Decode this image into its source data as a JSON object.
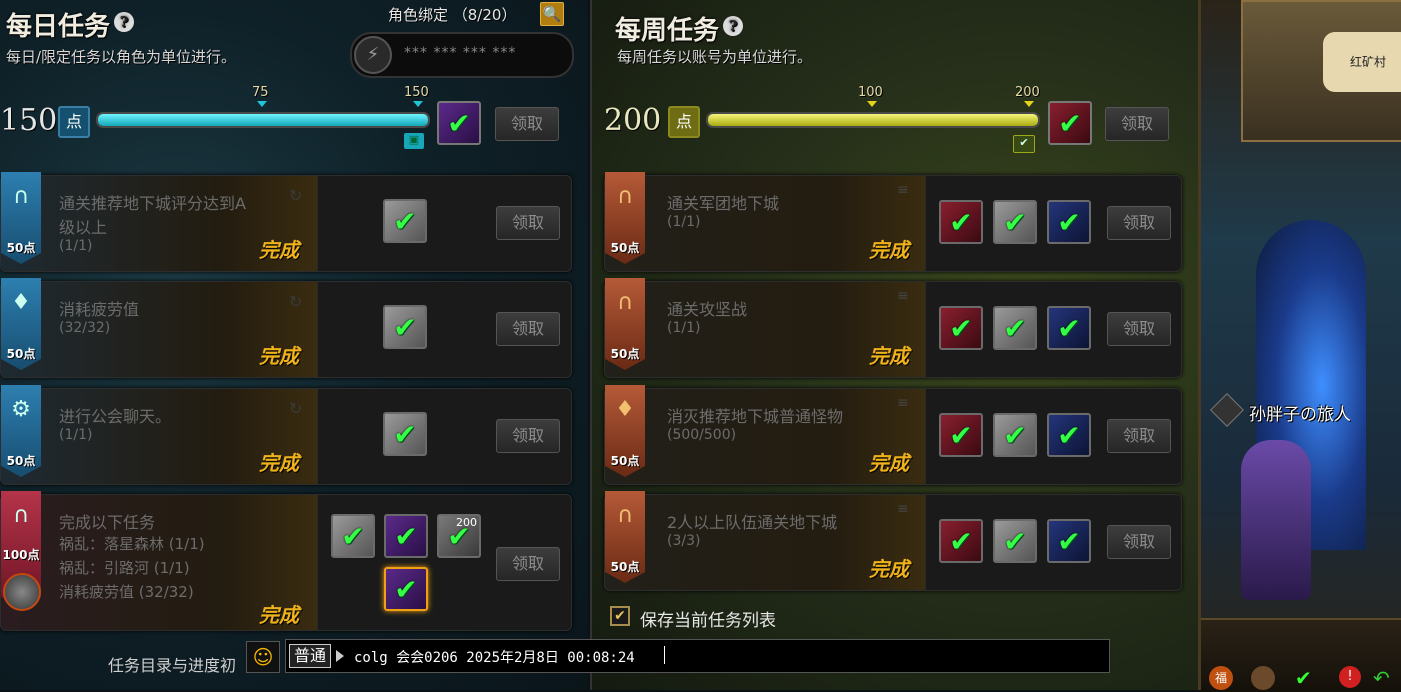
{
  "daily": {
    "title": "每日任务",
    "help": "?",
    "subtitle": "每日/限定任务以角色为单位进行。",
    "bind_label": "角色绑定 （8/20）",
    "search_icon": "search-icon",
    "masked_code": "*** *** *** ***",
    "points_value": "150",
    "points_unit": "点",
    "progress": {
      "current": 150,
      "max": 150,
      "marks": [
        75,
        150
      ],
      "mark_labels": [
        "75",
        "150"
      ]
    },
    "claim_label": "领取",
    "quests": [
      {
        "points": "50点",
        "name": "通关推荐地下城评分达到A级以上",
        "name_l1": "通关推荐地下城评分达到A",
        "name_l2": "级以上",
        "progress": "(1/1)",
        "status": "完成",
        "claim": "领取"
      },
      {
        "points": "50点",
        "name": "消耗疲劳值",
        "progress": "(32/32)",
        "status": "完成",
        "claim": "领取"
      },
      {
        "points": "50点",
        "name": "进行公会聊天。",
        "progress": "(1/1)",
        "status": "完成",
        "claim": "领取"
      },
      {
        "points": "100点",
        "name": "完成以下任务",
        "subs": [
          "祸乱：落星森林 (1/1)",
          "祸乱：引路河 (1/1)",
          "消耗疲劳值 (32/32)"
        ],
        "status": "完成",
        "claim": "领取",
        "reward_badge": "200"
      }
    ],
    "footer_text": "任务目录与进度初"
  },
  "weekly": {
    "title": "每周任务",
    "help": "?",
    "subtitle": "每周任务以账号为单位进行。",
    "points_value": "200",
    "points_unit": "点",
    "progress": {
      "current": 200,
      "max": 200,
      "marks": [
        100,
        200
      ],
      "mark_labels": [
        "100",
        "200"
      ]
    },
    "claim_label": "领取",
    "quests": [
      {
        "points": "50点",
        "name": "通关军团地下城",
        "progress": "(1/1)",
        "status": "完成",
        "claim": "领取"
      },
      {
        "points": "50点",
        "name": "通关攻坚战",
        "progress": "(1/1)",
        "status": "完成",
        "claim": "领取"
      },
      {
        "points": "50点",
        "name": "消灭推荐地下城普通怪物",
        "progress": "(500/500)",
        "status": "完成",
        "claim": "领取"
      },
      {
        "points": "50点",
        "name": "2人以上队伍通关地下城",
        "progress": "(3/3)",
        "status": "完成",
        "claim": "领取"
      }
    ],
    "save_label": "保存当前任务列表"
  },
  "chat": {
    "channel": "普通",
    "message": "colg 会会0206 2025年2月8日 00:08:24"
  },
  "scene": {
    "sign_text": "红矿村",
    "player_name": "孙胖子の旅人"
  },
  "colors": {
    "daily_bar": "#1fc6d8",
    "weekly_bar": "#c9cc1a",
    "done": "#f0b21a",
    "check": "#33ff44"
  }
}
